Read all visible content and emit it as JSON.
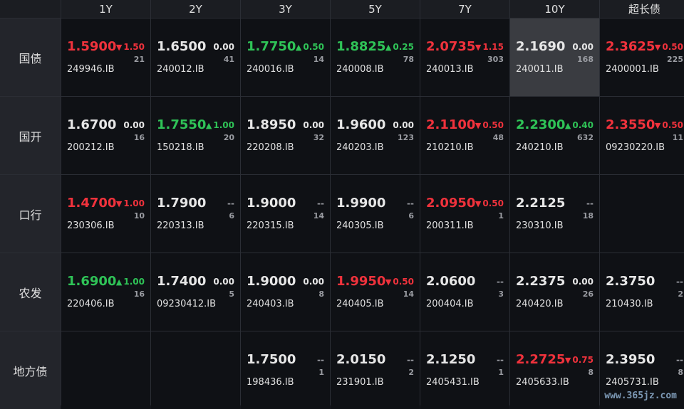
{
  "columns": [
    "1Y",
    "2Y",
    "3Y",
    "5Y",
    "7Y",
    "10Y",
    "超长债"
  ],
  "rows": [
    {
      "label": "国债",
      "cells": [
        {
          "yield": "1.5900",
          "dir": "down",
          "arrow": "▼",
          "chg": "1.50",
          "count": "21",
          "code": "249946.IB"
        },
        {
          "yield": "1.6500",
          "dir": "flat",
          "arrow": "",
          "chg": "0.00",
          "count": "41",
          "code": "240012.IB"
        },
        {
          "yield": "1.7750",
          "dir": "up",
          "arrow": "▲",
          "chg": "0.50",
          "count": "14",
          "code": "240016.IB"
        },
        {
          "yield": "1.8825",
          "dir": "up",
          "arrow": "▲",
          "chg": "0.25",
          "count": "78",
          "code": "240008.IB"
        },
        {
          "yield": "2.0735",
          "dir": "down",
          "arrow": "▼",
          "chg": "1.15",
          "count": "303",
          "code": "240013.IB"
        },
        {
          "yield": "2.1690",
          "dir": "flat",
          "arrow": "",
          "chg": "0.00",
          "count": "168",
          "code": "240011.IB",
          "selected": true
        },
        {
          "yield": "2.3625",
          "dir": "down",
          "arrow": "▼",
          "chg": "0.50",
          "count": "225",
          "code": "2400001.IB"
        }
      ]
    },
    {
      "label": "国开",
      "cells": [
        {
          "yield": "1.6700",
          "dir": "flat",
          "arrow": "",
          "chg": "0.00",
          "count": "16",
          "code": "200212.IB"
        },
        {
          "yield": "1.7550",
          "dir": "up",
          "arrow": "▲",
          "chg": "1.00",
          "count": "20",
          "code": "150218.IB"
        },
        {
          "yield": "1.8950",
          "dir": "flat",
          "arrow": "",
          "chg": "0.00",
          "count": "32",
          "code": "220208.IB"
        },
        {
          "yield": "1.9600",
          "dir": "flat",
          "arrow": "",
          "chg": "0.00",
          "count": "123",
          "code": "240203.IB"
        },
        {
          "yield": "2.1100",
          "dir": "down",
          "arrow": "▼",
          "chg": "0.50",
          "count": "48",
          "code": "210210.IB"
        },
        {
          "yield": "2.2300",
          "dir": "up",
          "arrow": "▲",
          "chg": "0.40",
          "count": "632",
          "code": "240210.IB"
        },
        {
          "yield": "2.3550",
          "dir": "down",
          "arrow": "▼",
          "chg": "0.50",
          "count": "11",
          "code": "09230220.IB"
        }
      ]
    },
    {
      "label": "口行",
      "cells": [
        {
          "yield": "1.4700",
          "dir": "down",
          "arrow": "▼",
          "chg": "1.00",
          "count": "10",
          "code": "230306.IB"
        },
        {
          "yield": "1.7900",
          "dir": "dash",
          "arrow": "",
          "chg": "--",
          "count": "6",
          "code": "220313.IB"
        },
        {
          "yield": "1.9000",
          "dir": "dash",
          "arrow": "",
          "chg": "--",
          "count": "14",
          "code": "220315.IB"
        },
        {
          "yield": "1.9900",
          "dir": "dash",
          "arrow": "",
          "chg": "--",
          "count": "6",
          "code": "240305.IB"
        },
        {
          "yield": "2.0950",
          "dir": "down",
          "arrow": "▼",
          "chg": "0.50",
          "count": "1",
          "code": "200311.IB"
        },
        {
          "yield": "2.2125",
          "dir": "dash",
          "arrow": "",
          "chg": "--",
          "count": "18",
          "code": "230310.IB"
        },
        null
      ]
    },
    {
      "label": "农发",
      "cells": [
        {
          "yield": "1.6900",
          "dir": "up",
          "arrow": "▲",
          "chg": "1.00",
          "count": "16",
          "code": "220406.IB"
        },
        {
          "yield": "1.7400",
          "dir": "flat",
          "arrow": "",
          "chg": "0.00",
          "count": "5",
          "code": "09230412.IB"
        },
        {
          "yield": "1.9000",
          "dir": "flat",
          "arrow": "",
          "chg": "0.00",
          "count": "8",
          "code": "240403.IB"
        },
        {
          "yield": "1.9950",
          "dir": "down",
          "arrow": "▼",
          "chg": "0.50",
          "count": "14",
          "code": "240405.IB"
        },
        {
          "yield": "2.0600",
          "dir": "dash",
          "arrow": "",
          "chg": "--",
          "count": "3",
          "code": "200404.IB"
        },
        {
          "yield": "2.2375",
          "dir": "flat",
          "arrow": "",
          "chg": "0.00",
          "count": "26",
          "code": "240420.IB"
        },
        {
          "yield": "2.3750",
          "dir": "dash",
          "arrow": "",
          "chg": "--",
          "count": "2",
          "code": "210430.IB"
        }
      ]
    },
    {
      "label": "地方债",
      "cells": [
        null,
        null,
        {
          "yield": "1.7500",
          "dir": "dash",
          "arrow": "",
          "chg": "--",
          "count": "1",
          "code": "198436.IB"
        },
        {
          "yield": "2.0150",
          "dir": "dash",
          "arrow": "",
          "chg": "--",
          "count": "2",
          "code": "231901.IB"
        },
        {
          "yield": "2.1250",
          "dir": "dash",
          "arrow": "",
          "chg": "--",
          "count": "1",
          "code": "2405431.IB"
        },
        {
          "yield": "2.2725",
          "dir": "down",
          "arrow": "▼",
          "chg": "0.75",
          "count": "8",
          "code": "2405633.IB"
        },
        {
          "yield": "2.3950",
          "dir": "dash",
          "arrow": "",
          "chg": "--",
          "count": "8",
          "code": "2405731.IB"
        }
      ]
    }
  ],
  "colors": {
    "up": "#2fc357",
    "down": "#f0323c",
    "flat": "#e6e6e6",
    "selected": "#3a3c41"
  },
  "watermark": "www.365jz.com"
}
